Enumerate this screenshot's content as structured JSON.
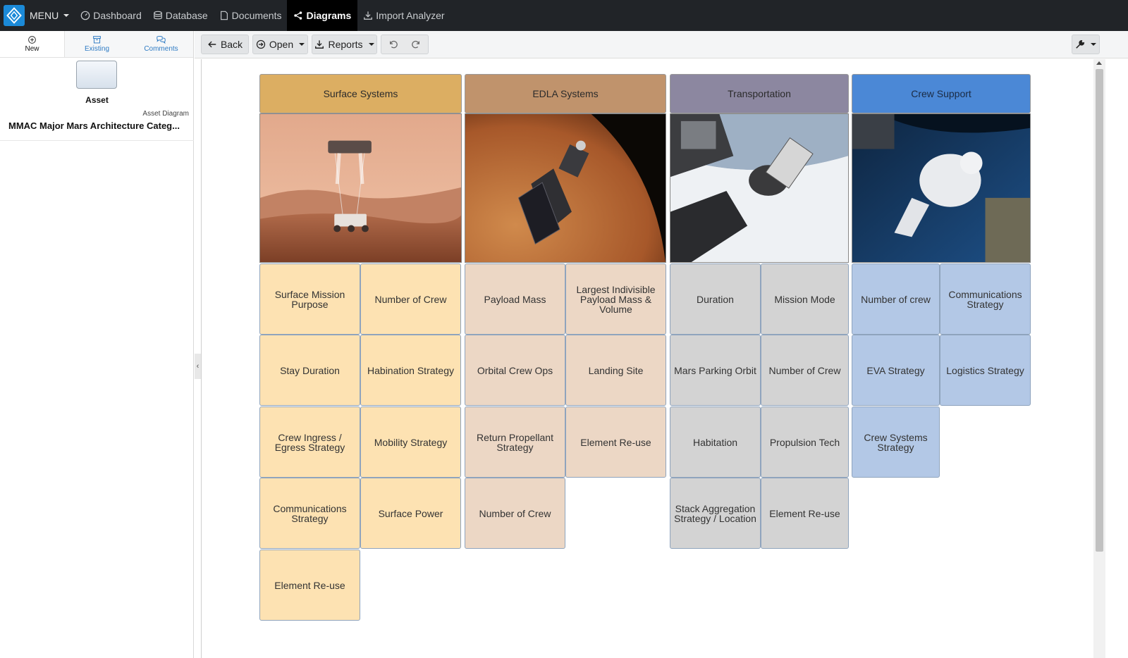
{
  "nav": {
    "menu_label": "MENU",
    "items": [
      {
        "label": "Dashboard",
        "icon": "dashboard-icon"
      },
      {
        "label": "Database",
        "icon": "database-icon"
      },
      {
        "label": "Documents",
        "icon": "document-icon"
      },
      {
        "label": "Diagrams",
        "icon": "diagram-icon",
        "active": true
      },
      {
        "label": "Import Analyzer",
        "icon": "import-icon"
      }
    ]
  },
  "sidebar": {
    "tabs": [
      {
        "label": "New",
        "icon": "plus-circle-icon",
        "active": true
      },
      {
        "label": "Existing",
        "icon": "archive-icon"
      },
      {
        "label": "Comments",
        "icon": "comments-icon"
      }
    ],
    "asset_label": "Asset",
    "diagram_type": "Asset Diagram",
    "diagram_name": "MMAC Major Mars Architecture Categ..."
  },
  "toolbar": {
    "back_label": "Back",
    "open_label": "Open",
    "reports_label": "Reports"
  },
  "diagram": {
    "columns": [
      {
        "title": "Surface Systems",
        "color": "#dcae62",
        "photo": "mars-landing-photo"
      },
      {
        "title": "EDLA Systems",
        "color": "#c0936c",
        "photo": "mars-orbiter-photo"
      },
      {
        "title": "Transportation",
        "color": "#8c87a0",
        "photo": "spacecraft-earth-photo"
      },
      {
        "title": "Crew Support",
        "color": "#4b88d6",
        "photo": "astronaut-eva-photo"
      }
    ],
    "surface": [
      [
        "Surface Mission Purpose",
        "Number of Crew"
      ],
      [
        "Stay Duration",
        "Habination Strategy"
      ],
      [
        "Crew Ingress / Egress Strategy",
        "Mobility Strategy"
      ],
      [
        "Communications Strategy",
        "Surface Power"
      ],
      [
        "Element Re-use"
      ]
    ],
    "edla": [
      [
        "Payload Mass",
        "Largest Indivisible Payload Mass & Volume"
      ],
      [
        "Orbital Crew Ops",
        "Landing Site"
      ],
      [
        "Return Propellant Strategy",
        "Element Re-use"
      ],
      [
        "Number of Crew"
      ]
    ],
    "transportation": [
      [
        "Duration",
        "Mission Mode"
      ],
      [
        "Mars Parking Orbit",
        "Number of Crew"
      ],
      [
        "Habitation",
        "Propulsion Tech"
      ],
      [
        "Stack Aggregation Strategy / Location",
        "Element Re-use"
      ]
    ],
    "crew": [
      [
        "Number of crew",
        "Communications Strategy"
      ],
      [
        "EVA Strategy",
        "Logistics Strategy"
      ],
      [
        "Crew Systems Strategy"
      ]
    ]
  }
}
